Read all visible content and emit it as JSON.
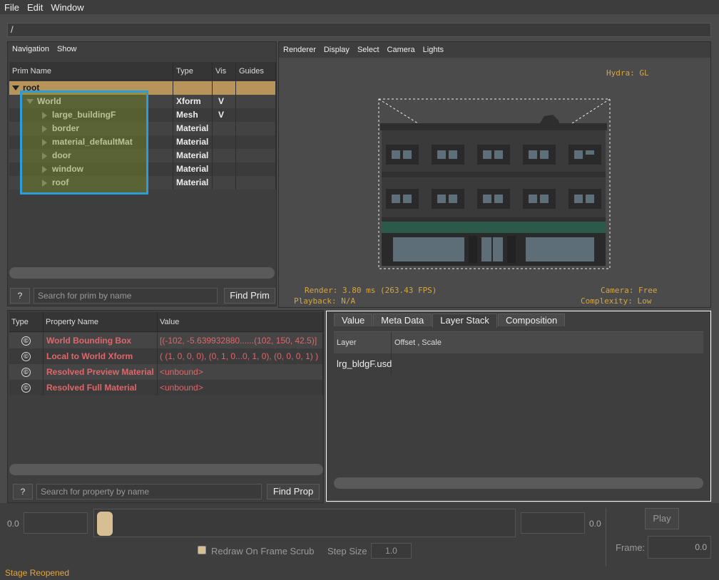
{
  "menu": {
    "file": "File",
    "edit": "Edit",
    "window": "Window"
  },
  "path": "/",
  "prim_browser": {
    "menu": [
      "Navigation",
      "Show"
    ],
    "columns": [
      "Prim Name",
      "Type",
      "Vis",
      "Guides"
    ],
    "rows": [
      {
        "name": "root",
        "type": "",
        "vis": ""
      },
      {
        "name": "World",
        "type": "Xform",
        "vis": "V"
      },
      {
        "name": "large_buildingF",
        "type": "Mesh",
        "vis": "V"
      },
      {
        "name": "border",
        "type": "Material",
        "vis": ""
      },
      {
        "name": "material_defaultMat",
        "type": "Material",
        "vis": ""
      },
      {
        "name": "door",
        "type": "Material",
        "vis": ""
      },
      {
        "name": "window",
        "type": "Material",
        "vis": ""
      },
      {
        "name": "roof",
        "type": "Material",
        "vis": ""
      }
    ],
    "help": "?",
    "search_placeholder": "Search for prim by name",
    "find_label": "Find Prim"
  },
  "viewport": {
    "menu": [
      "Renderer",
      "Display",
      "Select",
      "Camera",
      "Lights"
    ],
    "hydra": "Hydra: GL",
    "render": "Render: 3.80 ms (263.43 FPS)",
    "playback": "Playback: N/A",
    "camera": "Camera: Free",
    "complexity": "Complexity: Low"
  },
  "properties": {
    "columns": [
      "Type",
      "Property Name",
      "Value"
    ],
    "type_icon": "©",
    "rows": [
      {
        "name": "World Bounding Box",
        "value": "[(-102, -5.639932880......(102, 150, 42.5)]"
      },
      {
        "name": "Local to World Xform",
        "value": "( (1, 0, 0, 0), (0, 1, 0...0, 1, 0), (0, 0, 0, 1) )"
      },
      {
        "name": "Resolved Preview Material",
        "value": "<unbound>"
      },
      {
        "name": "Resolved Full Material",
        "value": "<unbound>"
      }
    ],
    "help": "?",
    "search_placeholder": "Search for property by name",
    "find_label": "Find Prop"
  },
  "layer_stack": {
    "tabs": [
      "Value",
      "Meta Data",
      "Layer Stack",
      "Composition"
    ],
    "active_tab": "Layer Stack",
    "columns": [
      "Layer",
      "Offset , Scale"
    ],
    "rows": [
      {
        "layer": "lrg_bldgF.usd",
        "offset": ""
      }
    ]
  },
  "timeline": {
    "start_value": "0.0",
    "end_value": "0.0",
    "play_label": "Play",
    "redraw_label": "Redraw On Frame Scrub",
    "step_size_label": "Step Size",
    "step_size_value": "1.0",
    "frame_label": "Frame:",
    "frame_value": "0.0"
  },
  "status": "Stage Reopened",
  "colors": {
    "accent": "#b6945a",
    "highlight": "#2d9cd8",
    "hud": "#d6a640",
    "property_red": "#e0666a",
    "status": "#e4a53b"
  }
}
